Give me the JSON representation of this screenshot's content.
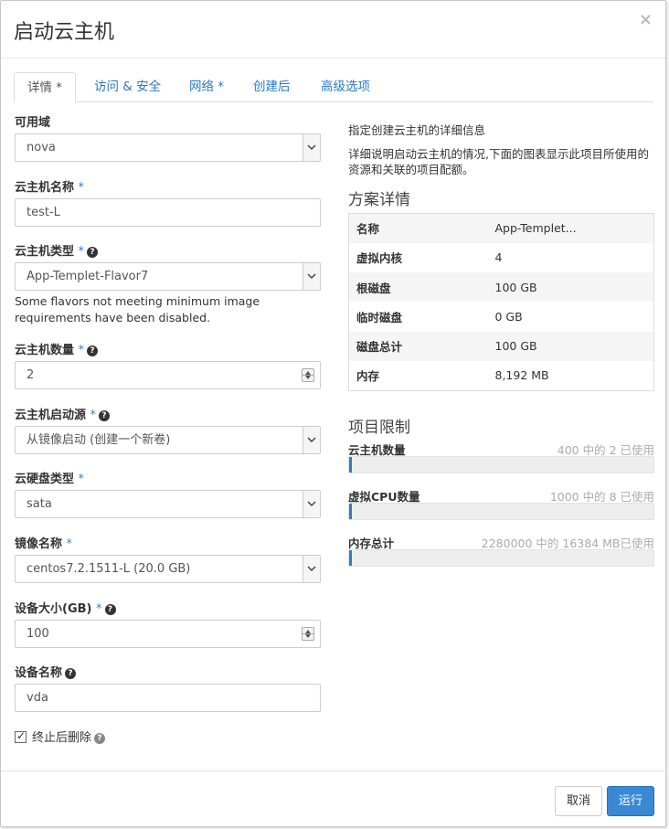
{
  "modal": {
    "title": "启动云主机",
    "close_label": "×"
  },
  "tabs": [
    {
      "label": "详情 *"
    },
    {
      "label": "访问 & 安全"
    },
    {
      "label": "网络 *"
    },
    {
      "label": "创建后"
    },
    {
      "label": "高级选项"
    }
  ],
  "form": {
    "availability_zone": {
      "label": "可用域",
      "value": "nova"
    },
    "instance_name": {
      "label": "云主机名称",
      "value": "test-L"
    },
    "flavor": {
      "label": "云主机类型",
      "value": "App-Templet-Flavor7",
      "hint": "Some flavors not meeting minimum image requirements have been disabled."
    },
    "instance_count": {
      "label": "云主机数量",
      "value": "2"
    },
    "boot_source": {
      "label": "云主机启动源",
      "value": "从镜像启动 (创建一个新卷)"
    },
    "volume_type": {
      "label": "云硬盘类型",
      "value": "sata"
    },
    "image_name": {
      "label": "镜像名称",
      "value": "centos7.2.1511-L (20.0 GB)"
    },
    "device_size": {
      "label": "设备大小(GB)",
      "value": "100"
    },
    "device_name": {
      "label": "设备名称",
      "value": "vda"
    },
    "delete_on_terminate": {
      "label": "终止后删除",
      "checked": true
    },
    "required_mark": "*",
    "help_glyph": "?"
  },
  "details": {
    "intro_title": "指定创建云主机的详细信息",
    "intro_text": "详细说明启动云主机的情况,下面的图表显示此项目所使用的资源和关联的项目配额。",
    "flavor_title": "方案详情",
    "flavor_rows": [
      {
        "key": "名称",
        "value": "App-Templet..."
      },
      {
        "key": "虚拟内核",
        "value": "4"
      },
      {
        "key": "根磁盘",
        "value": "100 GB"
      },
      {
        "key": "临时磁盘",
        "value": "0 GB"
      },
      {
        "key": "磁盘总计",
        "value": "100 GB"
      },
      {
        "key": "内存",
        "value": "8,192 MB"
      }
    ],
    "limits_title": "项目限制",
    "limits": [
      {
        "name": "云主机数量",
        "usage": "400 中的 2 已使用",
        "fraction": 0.005
      },
      {
        "name": "虚拟CPU数量",
        "usage": "1000 中的 8 已使用",
        "fraction": 0.008
      },
      {
        "name": "内存总计",
        "usage": "2280000 中的 16384 MB已使用",
        "fraction": 0.0072
      }
    ]
  },
  "footer": {
    "cancel_label": "取消",
    "run_label": "运行"
  },
  "colors": {
    "accent": "#3a89d4",
    "link": "#2a78c7",
    "bar_fill": "#2d7cc6"
  }
}
